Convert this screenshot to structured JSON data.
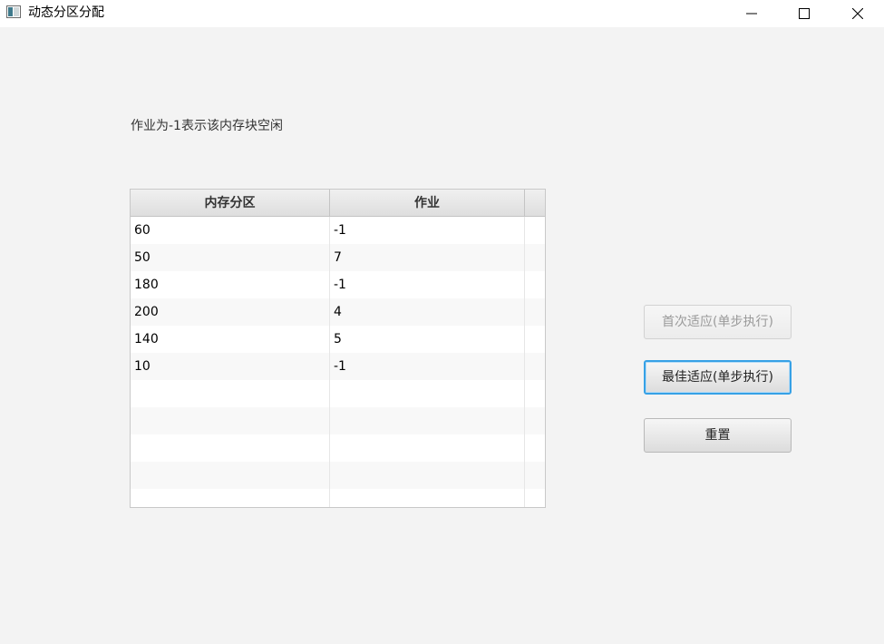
{
  "window": {
    "title": "动态分区分配"
  },
  "hint": "作业为-1表示该内存块空闲",
  "table": {
    "columns": [
      "内存分区",
      "作业"
    ],
    "rows": [
      {
        "partition": "60",
        "job": "-1"
      },
      {
        "partition": "50",
        "job": "7"
      },
      {
        "partition": "180",
        "job": "-1"
      },
      {
        "partition": "200",
        "job": "4"
      },
      {
        "partition": "140",
        "job": "5"
      },
      {
        "partition": "10",
        "job": "-1"
      },
      {
        "partition": "",
        "job": ""
      },
      {
        "partition": "",
        "job": ""
      },
      {
        "partition": "",
        "job": ""
      },
      {
        "partition": "",
        "job": ""
      },
      {
        "partition": "",
        "job": ""
      }
    ]
  },
  "buttons": {
    "first_fit": "首次适应(单步执行)",
    "best_fit": "最佳适应(单步执行)",
    "reset": "重置"
  },
  "icons": {
    "app": "app-window-icon",
    "minimize": "minimize-icon",
    "maximize": "maximize-icon",
    "close": "close-icon"
  },
  "colors": {
    "focus_border": "#36a1e6",
    "disabled_text": "#9a9a9a"
  }
}
